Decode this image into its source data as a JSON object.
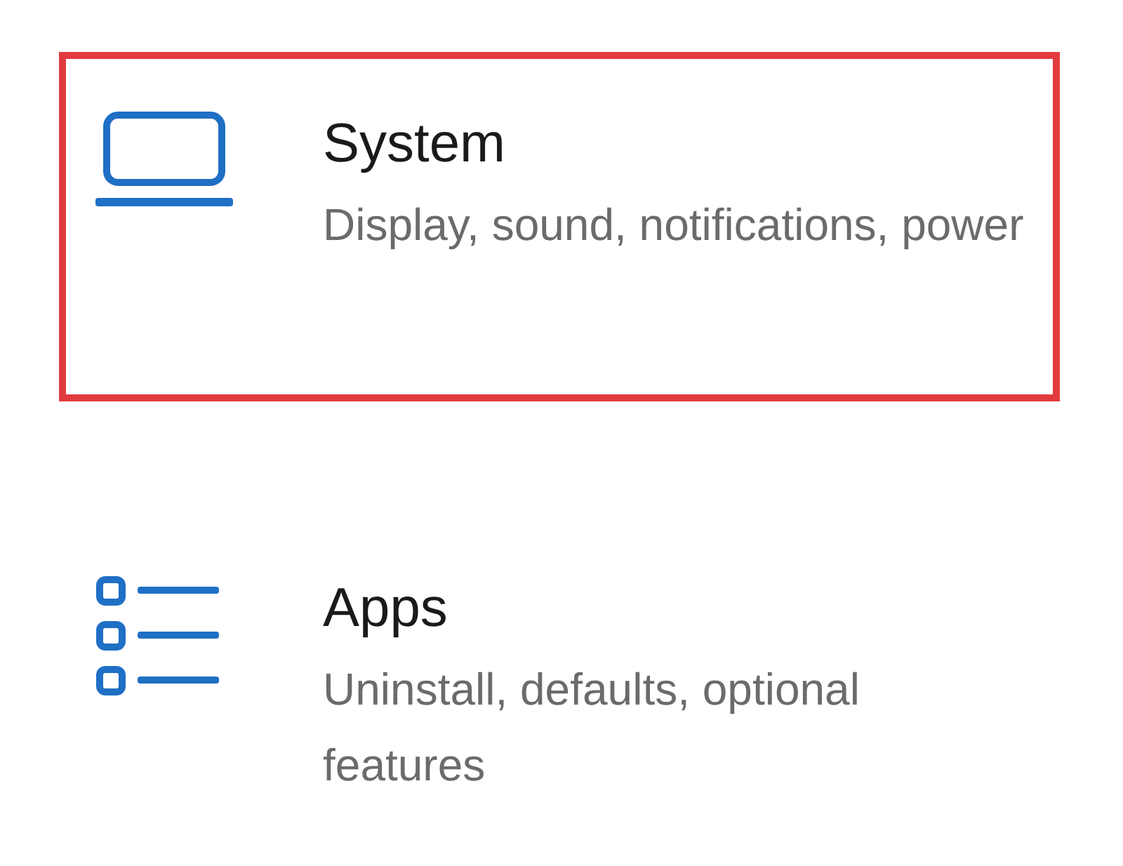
{
  "items": [
    {
      "kind": "laptop",
      "title": "System",
      "description": "Display, sound, notifications, power",
      "highlighted": true
    },
    {
      "kind": "list",
      "title": "Apps",
      "description": "Uninstall, defaults, optional features",
      "highlighted": false
    }
  ]
}
